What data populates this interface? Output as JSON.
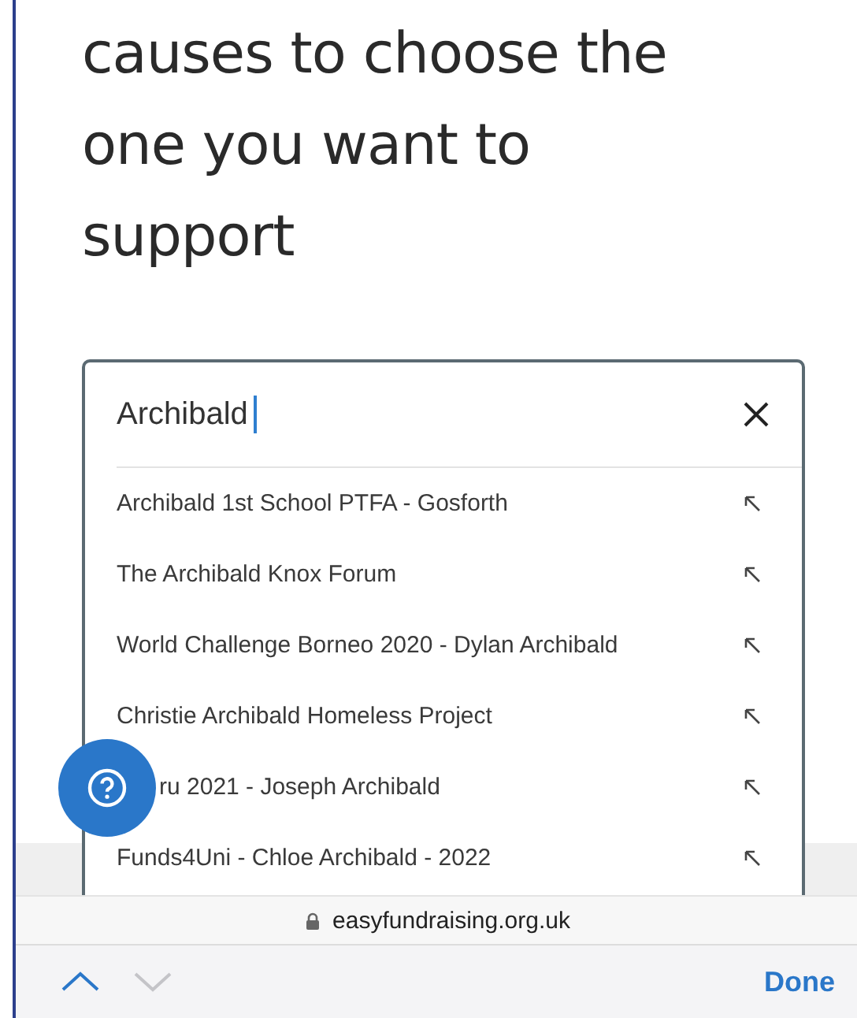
{
  "heading": "causes to choose the one you want to support",
  "search": {
    "value": "Archibald",
    "focused": true
  },
  "suggestions": [
    {
      "label": "Archibald 1st School PTFA - Gosforth",
      "covered": false
    },
    {
      "label": "The Archibald Knox Forum",
      "covered": false
    },
    {
      "label": "World Challenge Borneo 2020 - Dylan Archibald",
      "covered": false
    },
    {
      "label": "Christie Archibald Homeless Project",
      "covered": false
    },
    {
      "label": "ru 2021 - Joseph Archibald",
      "covered": true
    },
    {
      "label": "Funds4Uni - Chloe Archibald - 2022",
      "covered": false
    }
  ],
  "address_bar": {
    "url": "easyfundraising.org.uk"
  },
  "toolbar": {
    "previous_disabled": false,
    "next_disabled": true,
    "done": "Done"
  }
}
